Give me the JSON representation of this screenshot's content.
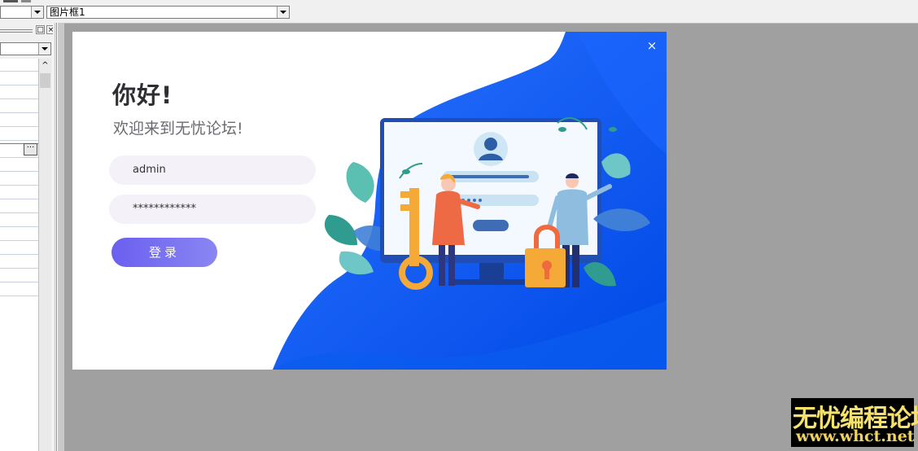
{
  "toolbar": {
    "object_selector": {
      "value": ""
    },
    "event_selector": {
      "value": "图片框1"
    }
  },
  "panel": {
    "restore_label": "□",
    "close_label": "×",
    "ellipsis_label": "···",
    "scroll_up_label": "^"
  },
  "login_card": {
    "close_label": "×",
    "greeting": "你好!",
    "welcome_text": "欢迎来到无忧论坛!",
    "username": {
      "value": "admin"
    },
    "password": {
      "value": "************"
    },
    "submit_label": "登录"
  },
  "colors": {
    "accent": "#0a57ec",
    "button_gradient_start": "#6a5ff0",
    "button_gradient_end": "#8a86f2",
    "workspace_bg": "#a0a0a0"
  },
  "watermark": {
    "line1": "无忧编程论坛",
    "line2": "www.whct.net"
  }
}
